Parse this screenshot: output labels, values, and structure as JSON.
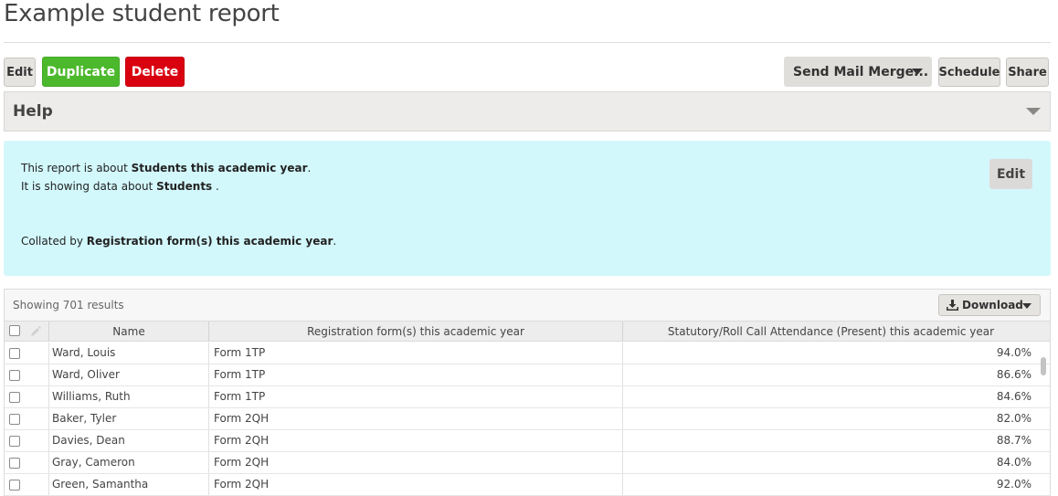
{
  "page": {
    "title": "Example student report"
  },
  "toolbar": {
    "edit_label": "Edit",
    "duplicate_label": "Duplicate",
    "delete_label": "Delete",
    "mail_merge_label": "Send Mail Merge...",
    "schedule_label": "Schedule",
    "share_label": "Share"
  },
  "help": {
    "title": "Help"
  },
  "info": {
    "line1_prefix": "This report is about ",
    "line1_bold": "Students this academic year",
    "line1_suffix": ".",
    "line2_prefix": "It is showing data about ",
    "line2_bold": "Students",
    "line2_suffix": " .",
    "line3_prefix": "Collated by ",
    "line3_bold": "Registration form(s) this academic year",
    "line3_suffix": ".",
    "edit_label": "Edit"
  },
  "grid": {
    "showing_text": "Showing 701 results",
    "download_label": "Download",
    "columns": {
      "name": "Name",
      "form": "Registration form(s) this academic year",
      "attendance": "Statutory/Roll Call Attendance (Present) this academic year"
    },
    "rows": [
      {
        "name": "Ward, Louis",
        "form": "Form 1TP",
        "attendance": "94.0%"
      },
      {
        "name": "Ward, Oliver",
        "form": "Form 1TP",
        "attendance": "86.6%"
      },
      {
        "name": "Williams, Ruth",
        "form": "Form 1TP",
        "attendance": "84.6%"
      },
      {
        "name": "Baker, Tyler",
        "form": "Form 2QH",
        "attendance": "82.0%"
      },
      {
        "name": "Davies, Dean",
        "form": "Form 2QH",
        "attendance": "88.7%"
      },
      {
        "name": "Gray, Cameron",
        "form": "Form 2QH",
        "attendance": "84.0%"
      },
      {
        "name": "Green, Samantha",
        "form": "Form 2QH",
        "attendance": "92.0%"
      }
    ]
  },
  "colors": {
    "duplicate": "#4cb92d",
    "delete": "#d9000f",
    "info_background": "#d3f8fc"
  },
  "icons": {
    "mail_merge_caret": "caret-down-icon",
    "help_toggle": "chevron-down-icon",
    "download": "download-icon",
    "select_all": "checkbox-icon",
    "edit_column": "pencil-icon"
  }
}
